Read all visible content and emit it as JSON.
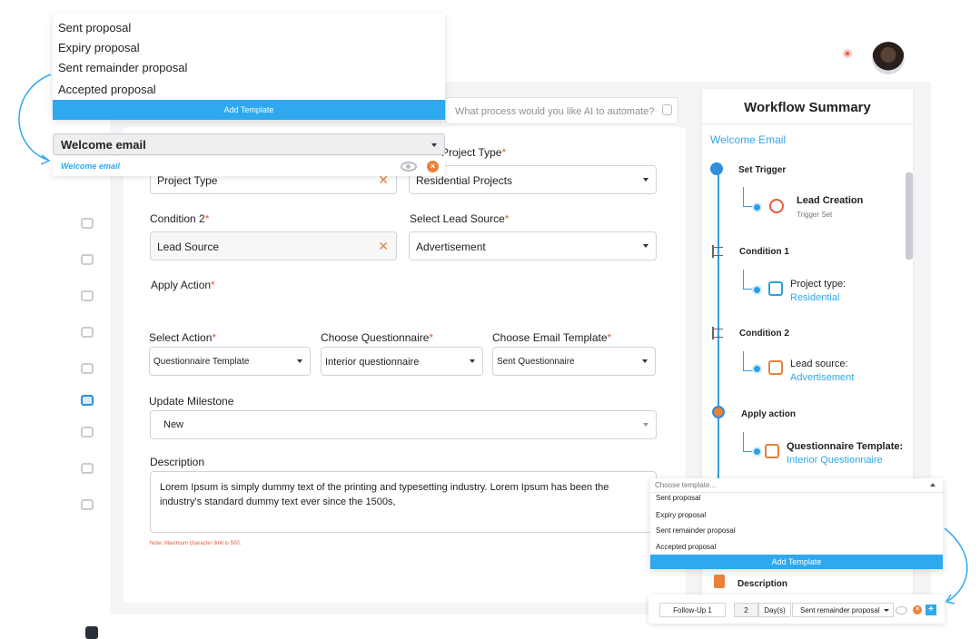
{
  "colors": {
    "accent": "#2ea8ee",
    "danger": "#e8583a",
    "orange": "#e8813a"
  },
  "top_menu": {
    "items": [
      "Sent proposal",
      "Expiry proposal",
      "Sent remainder proposal",
      "Accepted proposal"
    ],
    "add_label": "Add Template"
  },
  "welcome": {
    "select_value": "Welcome email",
    "option_label": "Welcome email"
  },
  "ai": {
    "placeholder": "What process would you like AI to automate?"
  },
  "form": {
    "project_type_label": "Project Type",
    "condition1_value": "Project Type",
    "project_type_value": "Residential Projects",
    "condition2_label": "Condition 2",
    "condition2_value": "Lead Source",
    "lead_source_label": "Select Lead Source",
    "lead_source_value": "Advertisement",
    "apply_action_label": "Apply Action",
    "select_action_label": "Select Action",
    "select_action_value": "Questionnaire Template",
    "questionnaire_label": "Choose Questionnaire",
    "questionnaire_value": "Interior questionnaire",
    "email_template_label": "Choose Email Template",
    "email_template_value": "Sent Questionnaire",
    "milestone_label": "Update Milestone",
    "milestone_value": "New",
    "description_label": "Description",
    "description_text": "Lorem Ipsum is simply dummy text of the printing and typesetting industry. Lorem Ipsum has been the industry's standard dummy text ever since the 1500s,",
    "note": "Note: Maximum character limit is 500.",
    "required_mark": "*",
    "clear_mark": "✕"
  },
  "summary": {
    "title": "Workflow Summary",
    "subtitle": "Welcome Email",
    "set_trigger": "Set Trigger",
    "trigger_main": "Lead Creation",
    "trigger_sub": "Trigger Set",
    "condition1": "Condition 1",
    "cond1_main": "Project type:",
    "cond1_value": "Residential",
    "condition2": "Condition 2",
    "cond2_main": "Lead source:",
    "cond2_value": "Advertisement",
    "apply_action": "Apply action",
    "action_main": "Questionnaire Template:",
    "action_value": "Interior Questionnaire",
    "description": "Description"
  },
  "right_menu": {
    "placeholder": "Choose template...",
    "items": [
      "Sent proposal",
      "Expiry proposal",
      "Sent remainder proposal",
      "Accepted proposal"
    ],
    "add_label": "Add Template"
  },
  "followup": {
    "name": "Follow-Up 1",
    "days": "2",
    "days_unit": "Day(s)",
    "template": "Sent remainder proposal",
    "plus": "+",
    "close": "×"
  },
  "welcome_close": "×"
}
